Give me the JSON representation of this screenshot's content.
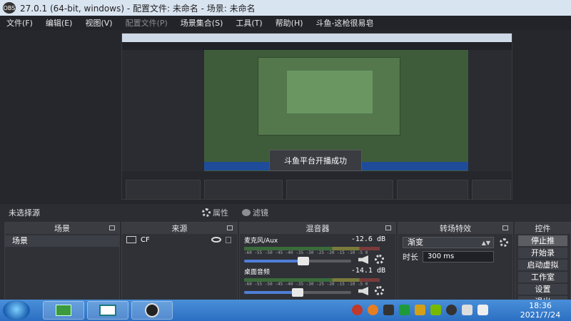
{
  "window": {
    "title": "27.0.1 (64-bit, windows) - 配置文件: 未命名 - 场景: 未命名",
    "app_label": "OBS"
  },
  "menu": [
    "文件(F)",
    "编辑(E)",
    "视图(V)",
    "配置文件(P)",
    "场景集合(S)",
    "工具(T)",
    "帮助(H)",
    "斗鱼-这枪很易皂"
  ],
  "preview": {
    "toast": "斗鱼平台开播成功"
  },
  "source_toolbar": {
    "no_source": "未选择源",
    "properties": "属性",
    "filters": "滤镜"
  },
  "docks": {
    "scenes": {
      "title": "场景",
      "items": [
        "场景"
      ]
    },
    "sources": {
      "title": "来源",
      "items": [
        {
          "name": "CF"
        }
      ]
    },
    "mixer": {
      "title": "混音器",
      "scale": "-60 -55 -50 -45 -40 -35 -30 -25 -20 -15 -10 -5 0",
      "channels": [
        {
          "name": "麦克风/Aux",
          "db": "-12.6 dB",
          "level": 0.55
        },
        {
          "name": "桌面音频",
          "db": "-14.1 dB",
          "level": 0.5
        }
      ]
    },
    "transitions": {
      "title": "转场特效",
      "selected": "渐变",
      "duration_label": "时长",
      "duration_value": "300 ms"
    },
    "controls": {
      "title": "控件",
      "buttons": [
        "停止推",
        "开始录",
        "启动虚拟",
        "工作室",
        "设置",
        "退出"
      ]
    }
  },
  "taskbar": {
    "time": "18:36",
    "date": "2021/7/24"
  },
  "colors": {
    "accent": "#4f7fd6",
    "taskbar": "#2c6fc2",
    "panel": "#2f3137"
  }
}
